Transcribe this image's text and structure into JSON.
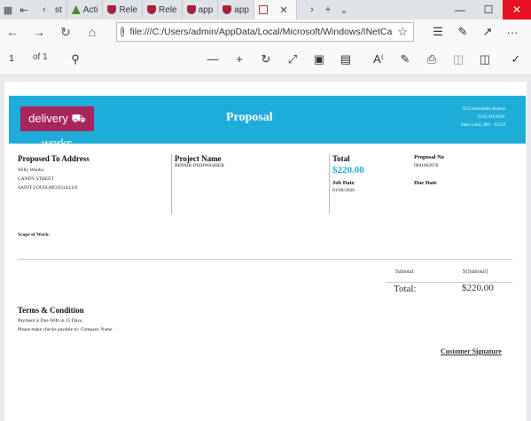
{
  "browser": {
    "tabs": [
      {
        "label": "st",
        "icon": "doc-icon"
      },
      {
        "label": "Acti",
        "icon": "triangle-icon"
      },
      {
        "label": "Rele",
        "icon": "shield-icon"
      },
      {
        "label": "Rele",
        "icon": "shield-icon"
      },
      {
        "label": "app",
        "icon": "shield-icon"
      },
      {
        "label": "app",
        "icon": "shield-icon"
      },
      {
        "label": "",
        "icon": "pdf-icon",
        "active": true
      }
    ],
    "address": "file:///C:/Users/admin/AppData/Local/Microsoft/Windows/INetCa"
  },
  "pdf_toolbar": {
    "page_number": "1",
    "page_of": "of 1"
  },
  "document": {
    "logo_text": "delivery ⛟ works",
    "title": "Proposal",
    "company_address": [
      "59 Lamlwheitin Avenue",
      "(512) 018-0101",
      "Saint Louis, MO - 63124"
    ],
    "proposed_to": {
      "heading": "Proposed To Address",
      "lines": [
        "Willy Wonka",
        "CANDY STREET",
        "SAINT LOUIS,MO,63144,US"
      ]
    },
    "project": {
      "heading": "Project Name",
      "name": "REPAIR DISHWASHER"
    },
    "total": {
      "heading": "Total",
      "amount": "$220.00"
    },
    "proposal_no": {
      "heading": "Proposal No",
      "value": "0841862078"
    },
    "job_date": {
      "heading": "Job Date",
      "value": "01/08/2020"
    },
    "due_date": {
      "heading": "Due Date"
    },
    "scope_label": "Scope of Work:",
    "subtotal_label": "Subtotal:",
    "subtotal_value": "${Subtotal}",
    "total_label": "Total:",
    "total_value": "$220.00",
    "terms_heading": "Terms & Condition",
    "terms_lines": [
      "Payment is Due With in 15 Days.",
      "Please make checks payable to: Company Name"
    ],
    "signature_label": "Customer Signature"
  }
}
